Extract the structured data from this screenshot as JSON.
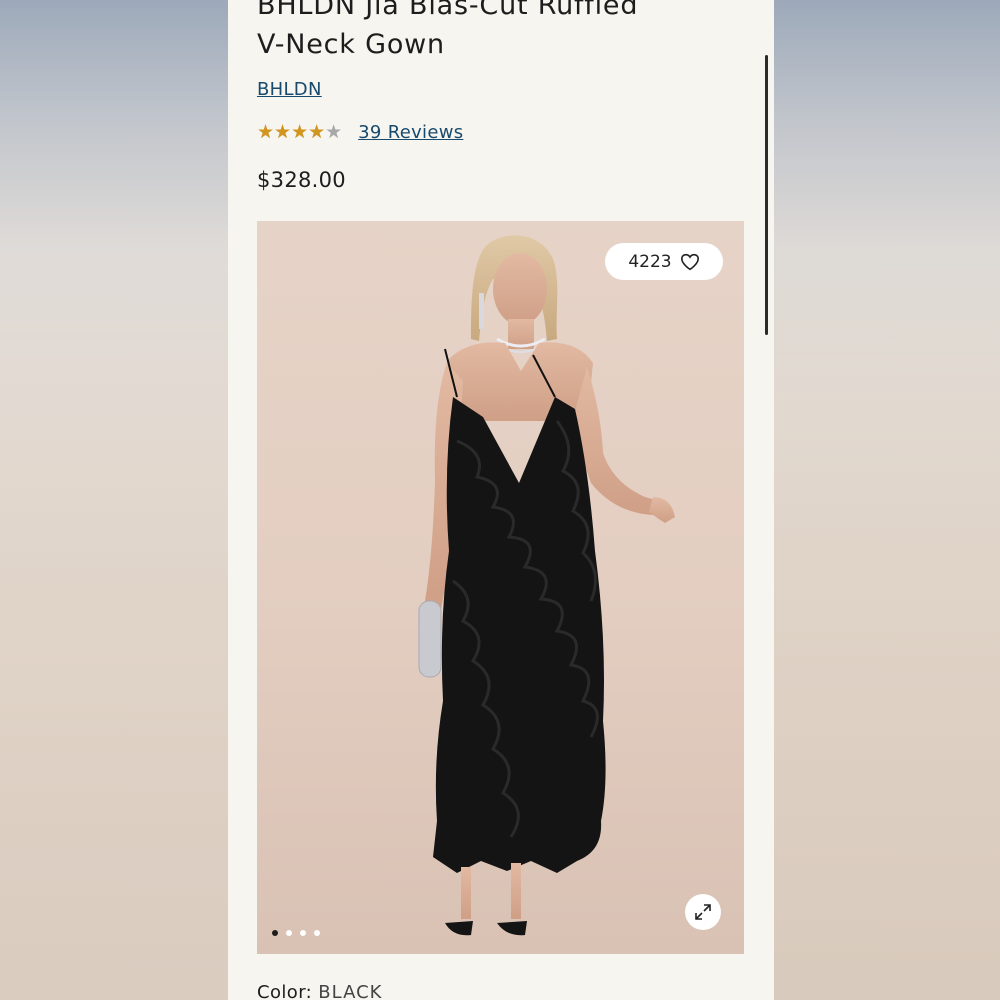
{
  "product": {
    "title_line1": "BHLDN Jia Bias-Cut Ruffled",
    "title_line2": "V-Neck Gown",
    "brand": "BHLDN",
    "rating_value": 4,
    "rating_max": 5,
    "reviews_label": "39 Reviews",
    "price": "$328.00",
    "likes_count": "4223",
    "color_label": "Color:",
    "color_value": "BLACK"
  },
  "gallery": {
    "image_count": 4,
    "active_index": 0
  },
  "colors": {
    "link": "#174a6d",
    "star": "#d2961f",
    "page_bg": "#f7f5f0",
    "photo_bg": "#e3cec1",
    "gown": "#141414"
  },
  "icons": {
    "like": "heart-icon",
    "expand": "expand-icon"
  }
}
